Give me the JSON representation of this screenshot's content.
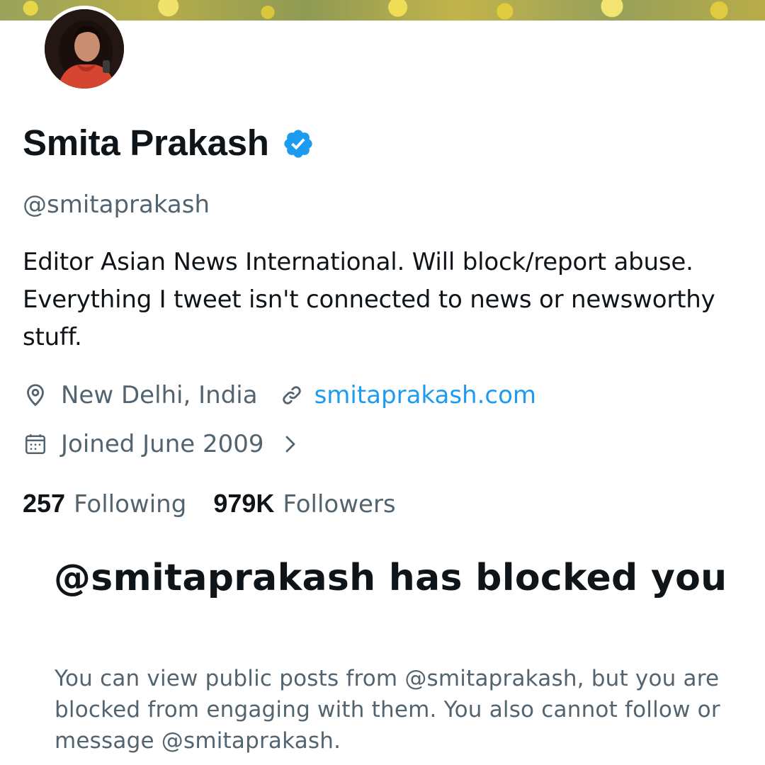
{
  "profile": {
    "display_name": "Smita Prakash",
    "verified": true,
    "handle": "@smitaprakash",
    "bio": "Editor Asian News International. Will block/report abuse. Everything I tweet isn't connected to news or newsworthy stuff.",
    "location": "New Delhi, India",
    "website": "smitaprakash.com",
    "joined": "Joined June 2009"
  },
  "stats": {
    "following_count": "257",
    "following_label": "Following",
    "followers_count": "979K",
    "followers_label": "Followers"
  },
  "blocked_notice": {
    "title": "@smitaprakash has blocked you",
    "description": "You can view public posts from @smitaprakash, but you are blocked from engaging with them. You also cannot follow or message @smitaprakash."
  },
  "colors": {
    "accent": "#1d9bf0",
    "text_primary": "#0f1419",
    "text_secondary": "#536471"
  },
  "icons": {
    "verified": "verified-badge-icon",
    "location": "location-pin-icon",
    "link": "link-icon",
    "calendar": "calendar-icon",
    "chevron": "chevron-right-icon"
  }
}
